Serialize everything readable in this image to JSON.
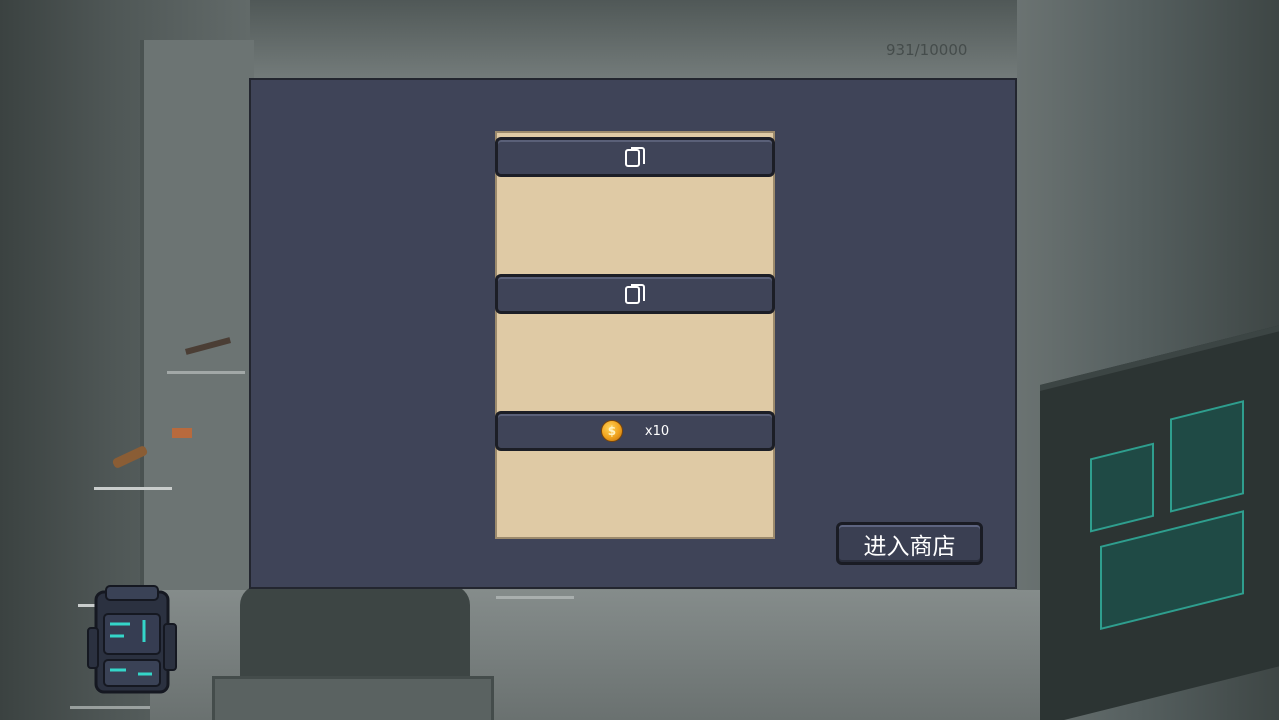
{
  "hud": {
    "counter_text": "931/10000"
  },
  "panel": {
    "slots": [
      {
        "icon": "card-icon"
      },
      {
        "icon": "card-icon"
      },
      {
        "icon": "coin-icon",
        "coin_symbol": "$",
        "quantity_label": "x10"
      }
    ],
    "shop_button_label": "进入商店"
  },
  "colors": {
    "panel_bg": "#3f4458",
    "paper_bg": "#dfcaa5",
    "bar_bg": "#3f4458",
    "coin_gold": "#f0a21c",
    "backpack_glow": "#34d6c9"
  },
  "inventory": {
    "icon": "backpack-icon"
  }
}
